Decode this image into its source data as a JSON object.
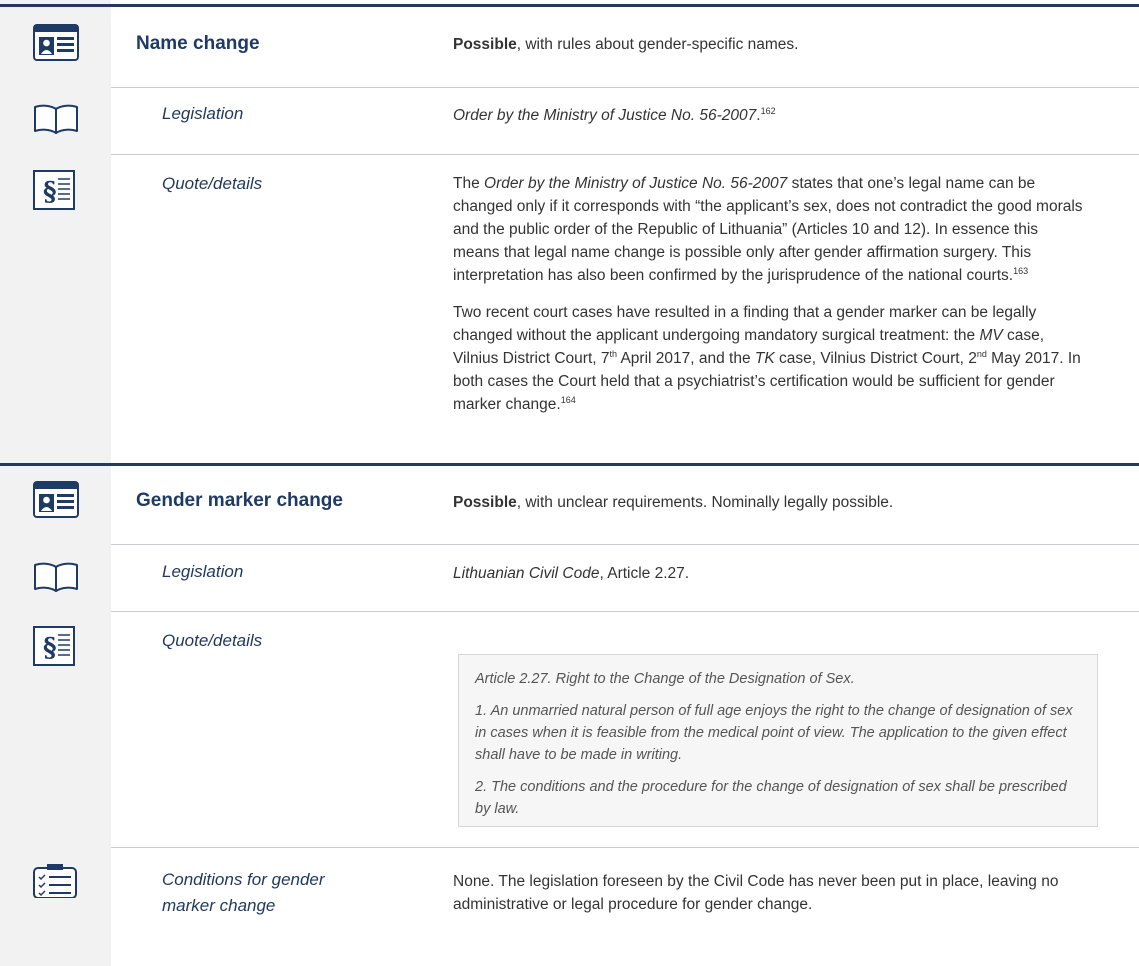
{
  "colors": {
    "accent": "#1f3a64",
    "rule": "#233a5e",
    "icon_column": "#f2f2f2"
  },
  "icons": {
    "id_card": "id-card-icon",
    "book": "open-book-icon",
    "paragraph": "paragraph-sign-icon",
    "checklist": "checklist-icon"
  },
  "name_change": {
    "title": "Name change",
    "status_bold": "Possible",
    "status_rest": ", with rules about gender-specific names.",
    "legislation": {
      "label": "Legislation",
      "text": "Order by the Ministry of Justice No. 56-2007",
      "period": ".",
      "footnote": "162"
    },
    "quote": {
      "label": "Quote/details",
      "p1_a": "The ",
      "p1_italic": "Order by the Ministry of Justice No. 56-2007",
      "p1_b": " states that one’s legal name can be changed only if it corresponds with “the applicant’s sex, does not contradict the good morals and the public order of the Republic of Lithuania” (Articles 10 and 12). In essence this means that legal name change is possible only after gender affirmation surgery. This interpretation has also been confirmed by the jurisprudence of the national courts.",
      "p1_fn": "163",
      "p2_a": "Two recent court cases have resulted in a finding that a gender marker can be legally changed without the applicant undergoing mandatory surgical treatment: the ",
      "p2_mv": "MV",
      "p2_b": " case, Vilnius District Court, 7",
      "p2_th": "th",
      "p2_c": " April 2017, and the ",
      "p2_tk": "TK",
      "p2_d": " case, Vilnius District Court, 2",
      "p2_nd": "nd",
      "p2_e": " May 2017. In both cases the Court held that a psychiatrist’s certification would be sufficient for gender marker change.",
      "p2_fn": "164"
    }
  },
  "gender_marker": {
    "title": "Gender marker change",
    "status_bold": "Possible",
    "status_rest": ", with unclear requirements. Nominally legally possible.",
    "legislation": {
      "label": "Legislation",
      "text_italic": "Lithuanian Civil Code",
      "text_rest": ", Article 2.27."
    },
    "quote": {
      "label": "Quote/details",
      "q1": "Article 2.27. Right to the Change of the Designation of Sex.",
      "q2": "1. An unmarried natural person of full age enjoys the right to the change of designation of sex in cases when it is feasible from the medical point of view. The application to the given effect shall have to be made in writing.",
      "q3": "2. The conditions and the procedure for the change of designation of sex shall be prescribed by law."
    },
    "conditions": {
      "label_line1": "Conditions for gender",
      "label_line2": "marker change",
      "text": "None. The legislation foreseen by the Civil Code has never been put in place, leaving no administrative or legal procedure for gender change."
    }
  }
}
